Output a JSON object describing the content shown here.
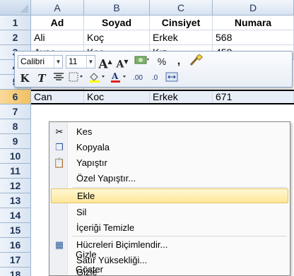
{
  "columns": [
    "A",
    "B",
    "C",
    "D"
  ],
  "rows": [
    "1",
    "2",
    "3",
    "4",
    "5",
    "6",
    "7",
    "8",
    "9",
    "10",
    "11",
    "12",
    "13",
    "14",
    "15",
    "16",
    "17",
    "18"
  ],
  "cells": {
    "r1": [
      "Ad",
      "Soyad",
      "Cinsiyet",
      "Numara"
    ],
    "r2": [
      "Ali",
      "Koç",
      "Erkek",
      "568"
    ],
    "r3": [
      "Ayşe",
      "Koç",
      "Kız",
      "458"
    ],
    "r6": [
      "Can",
      "Koc",
      "Erkek",
      "671"
    ]
  },
  "mini_toolbar": {
    "font": "Calibri",
    "size": "11",
    "grow": "A",
    "shrink": "A",
    "percent": "%",
    "comma": ",",
    "bold": "K",
    "italic": "T",
    "dec_inc": ".00",
    "dec_dec": ".0"
  },
  "menu": {
    "items": [
      {
        "label": "Kes",
        "icon": "scissors-icon",
        "glyph": "✂"
      },
      {
        "label": "Kopyala",
        "icon": "copy-icon",
        "glyph": "❐"
      },
      {
        "label": "Yapıştır",
        "icon": "paste-icon",
        "glyph": "📋"
      },
      {
        "label": "Özel Yapıştır...",
        "icon": "",
        "glyph": ""
      },
      {
        "label": "Ekle",
        "icon": "",
        "glyph": ""
      },
      {
        "label": "Sil",
        "icon": "",
        "glyph": ""
      },
      {
        "label": "İçeriği Temizle",
        "icon": "",
        "glyph": ""
      },
      {
        "label": "Hücreleri Biçimlendir...",
        "icon": "format-cells-icon",
        "glyph": "▦"
      },
      {
        "label": "Satır Yüksekliği...",
        "icon": "",
        "glyph": ""
      },
      {
        "label": "Gizle",
        "icon": "",
        "glyph": ""
      },
      {
        "label": "Göster",
        "icon": "",
        "glyph": ""
      }
    ]
  },
  "colors": {
    "highlight": "#fde79a",
    "header_blue": "#d6e2f1"
  }
}
